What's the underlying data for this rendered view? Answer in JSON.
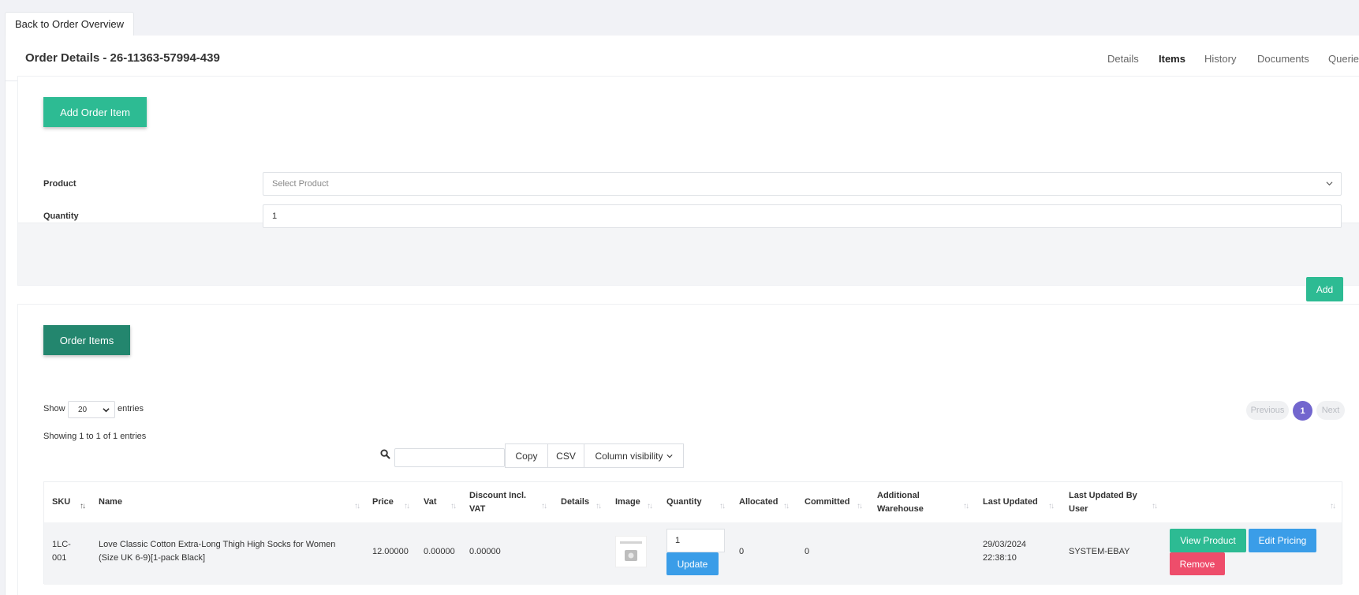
{
  "back_button": "Back to Order Overview",
  "header": {
    "title": "Order Details - 26-11363-57994-439",
    "tabs": [
      {
        "label": "Details"
      },
      {
        "label": "Items"
      },
      {
        "label": "History"
      },
      {
        "label": "Documents"
      },
      {
        "label": "Queries"
      }
    ],
    "active_tab": "Items"
  },
  "add_item": {
    "title": "Add Order Item",
    "product_label": "Product",
    "product_placeholder": "Select Product",
    "quantity_label": "Quantity",
    "quantity_value": "1",
    "add_button": "Add"
  },
  "order_items": {
    "title": "Order Items",
    "show_label": "Show",
    "page_length": "20",
    "entries_label": "entries",
    "info": "Showing 1 to 1 of 1 entries",
    "pager": {
      "previous": "Previous",
      "current": "1",
      "next": "Next"
    },
    "buttons": {
      "copy": "Copy",
      "csv": "CSV",
      "column_visibility": "Column visibility"
    },
    "columns": [
      "SKU",
      "Name",
      "Price",
      "Vat",
      "Discount Incl. VAT",
      "Details",
      "Image",
      "Quantity",
      "Allocated",
      "Committed",
      "Additional Warehouse",
      "Last Updated",
      "Last Updated By User",
      ""
    ],
    "rows": [
      {
        "sku": "1LC-001",
        "name": "Love Classic Cotton Extra-Long Thigh High Socks for Women (Size UK 6-9)[1-pack Black]",
        "price": "12.00000",
        "vat": "0.00000",
        "discount": "0.00000",
        "details": "",
        "image_alt": "Photo Not Available",
        "quantity": "1",
        "update_button": "Update",
        "allocated": "0",
        "committed": "0",
        "additional_warehouse": "",
        "last_updated": "29/03/2024 22:38:10",
        "last_updated_by": "SYSTEM-EBAY",
        "actions": {
          "view": "View Product",
          "edit": "Edit Pricing",
          "remove": "Remove"
        }
      }
    ]
  },
  "colors": {
    "teal": "#2dbb93",
    "dark_teal": "#23866e",
    "blue": "#3a9de8",
    "red": "#ee4d6b",
    "purple": "#7266ce"
  },
  "icons": {
    "search": "search-icon",
    "dropdown": "chevron-down-icon"
  }
}
